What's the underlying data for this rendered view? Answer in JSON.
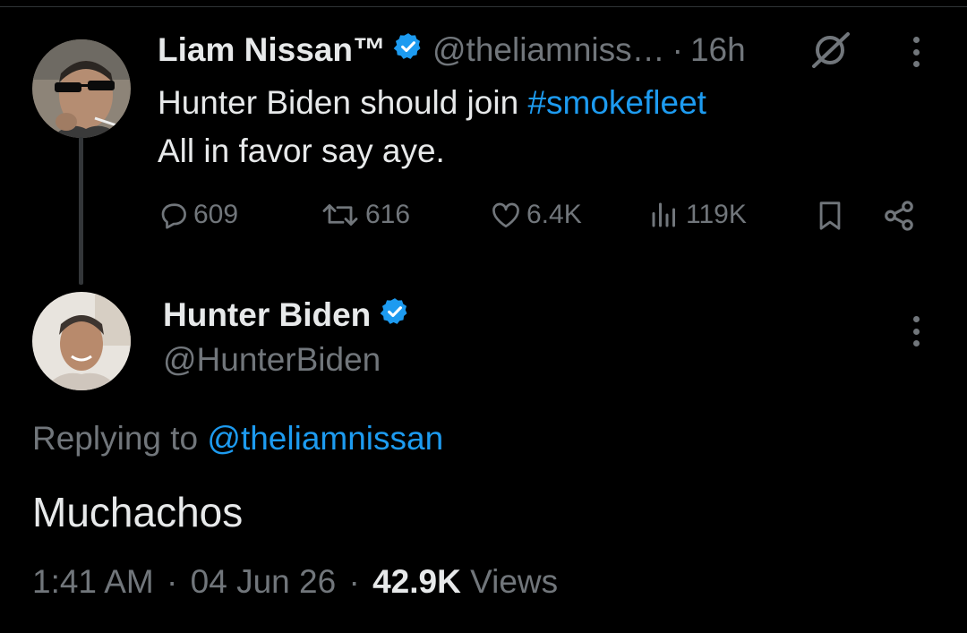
{
  "parent_tweet": {
    "author_name": "Liam Nissan™",
    "handle": "@theliamniss…",
    "separator": "·",
    "time": "16h",
    "text_prefix": "Hunter Biden should join ",
    "hashtag": "#smokefleet",
    "text_line2": "All in favor say aye.",
    "metrics": {
      "replies": "609",
      "retweets": "616",
      "likes": "6.4K",
      "views": "119K"
    }
  },
  "reply_tweet": {
    "author_name": "Hunter Biden",
    "handle": "@HunterBiden",
    "replying_label": "Replying to ",
    "replying_handle": "@theliamnissan",
    "text": "Muchachos",
    "time": "1:41 AM",
    "date": "04 Jun 26",
    "sep": "·",
    "views_count": "42.9K",
    "views_label": "Views"
  },
  "icons": [
    "verified-icon",
    "grok-icon",
    "more-icon",
    "reply-icon",
    "retweet-icon",
    "like-icon",
    "views-icon",
    "bookmark-icon",
    "share-icon"
  ],
  "colors": {
    "background": "#000000",
    "text": "#e7e9ea",
    "muted": "#71767b",
    "accent": "#1d9bf0"
  }
}
